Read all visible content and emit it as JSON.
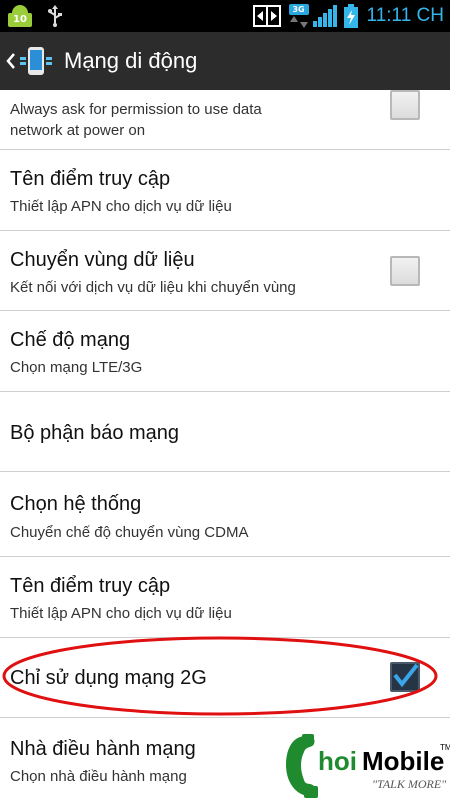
{
  "status_bar": {
    "android_badge": "10",
    "network_type": "3G",
    "time": "11:11 CH",
    "icons": [
      "android-notification-icon",
      "usb-icon",
      "network-share-icon",
      "network-3g-icon",
      "signal-icon",
      "battery-charging-icon"
    ]
  },
  "action_bar": {
    "title": "Mạng di động",
    "icons": [
      "back-chevron-icon",
      "mobile-network-app-icon"
    ]
  },
  "settings": {
    "item0": {
      "summary_line1": "Always ask for permission to use data",
      "summary_line2": "network at power on",
      "checked": false
    },
    "item1": {
      "title": "Tên điểm truy cập",
      "summary": "Thiết lập APN cho dịch vụ dữ liệu"
    },
    "item2": {
      "title": "Chuyển vùng dữ liệu",
      "summary": "Kết nối với dịch vụ dữ liệu khi chuyển vùng",
      "checked": false
    },
    "item3": {
      "title": "Chế độ mạng",
      "summary": "Chọn mạng LTE/3G"
    },
    "item4": {
      "title": "Bộ phận báo mạng"
    },
    "item5": {
      "title": "Chọn hệ thống",
      "summary": "Chuyển chế độ chuyển vùng CDMA"
    },
    "item6": {
      "title": "Tên điểm truy cập",
      "summary": "Thiết lập APN cho dịch vụ dữ liệu"
    },
    "item7": {
      "title": "Chỉ sử dụng mạng 2G",
      "checked": true
    },
    "item8": {
      "title": "Nhà điều hành mạng",
      "summary": "Chọn nhà điều hành mạng"
    }
  },
  "annotation": {
    "color": "#e01010"
  },
  "watermark": {
    "brand": "ChoiMobile",
    "slogan": "\"TALK MORE\"",
    "tm": "TM"
  },
  "colors": {
    "accent": "#35b6ea",
    "status_bg": "#000000",
    "action_bg": "#2c2c2c"
  }
}
